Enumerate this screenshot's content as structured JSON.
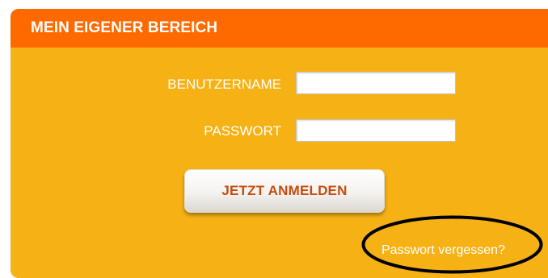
{
  "panel": {
    "title": "MEIN EIGENER BEREICH",
    "colors": {
      "header": "#ff6a00",
      "body": "#f6b115",
      "button_text": "#c64b0c"
    }
  },
  "form": {
    "username_label": "BENUTZERNAME",
    "username_value": "",
    "password_label": "PASSWORT",
    "password_value": "",
    "submit_label": "JETZT ANMELDEN",
    "forgot_link": "Passwort vergessen?"
  }
}
